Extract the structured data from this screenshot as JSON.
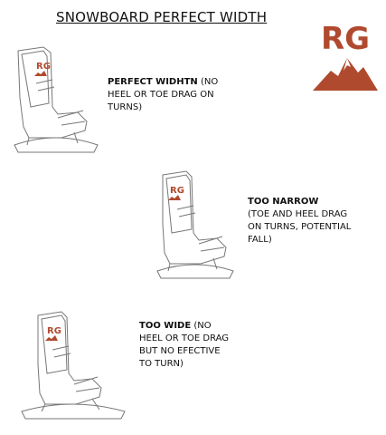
{
  "title": "SNOWBOARD PERFECT WIDTH",
  "logo": {
    "letters": "RG",
    "color": "#b04a2e"
  },
  "sections": [
    {
      "heading": "PERFECT WIDHTN",
      "text": " (NO HEEL OR TOE DRAG ON TURNS)",
      "badge": "RG"
    },
    {
      "heading": "TOO NARROW",
      "text": "(TOE AND HEEL DRAG ON TURNS, POTENTIAL FALL)",
      "badge": "RG"
    },
    {
      "heading": "TOO WIDE",
      "text": " (NO HEEL OR TOE DRAG BUT NO EFECTIVE TO TURN)",
      "badge": "RG"
    }
  ]
}
